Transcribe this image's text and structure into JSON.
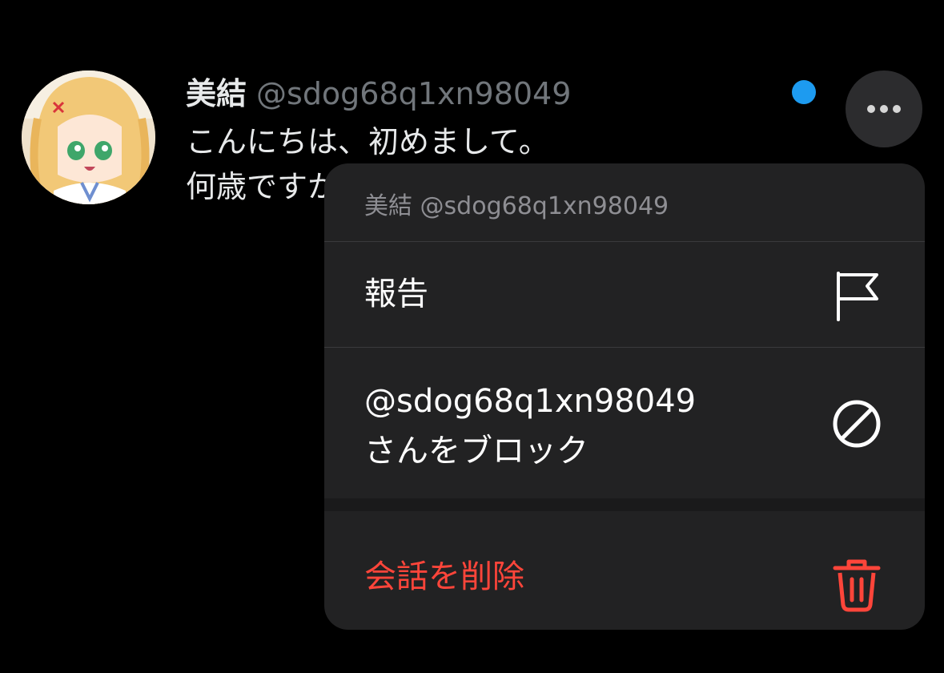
{
  "conversation": {
    "sender_name": "美結",
    "sender_handle": "@sdog68q1xn98049",
    "message_lines": [
      "こんにちは、初めまして。",
      "何歳ですか"
    ],
    "avatar_icon": "avatar-anime-girl",
    "unread_indicator_color": "#1d9bf0"
  },
  "more_button": {
    "icon": "ellipsis-icon"
  },
  "context_menu": {
    "header": "美結 @sdog68q1xn98049",
    "items": [
      {
        "label": "報告",
        "icon": "flag-icon"
      },
      {
        "label_lines": [
          "@sdog68q1xn98049",
          "さんをブロック"
        ],
        "icon": "block-icon"
      },
      {
        "label": "会話を削除",
        "icon": "trash-icon",
        "color": "#ff453a"
      }
    ]
  }
}
